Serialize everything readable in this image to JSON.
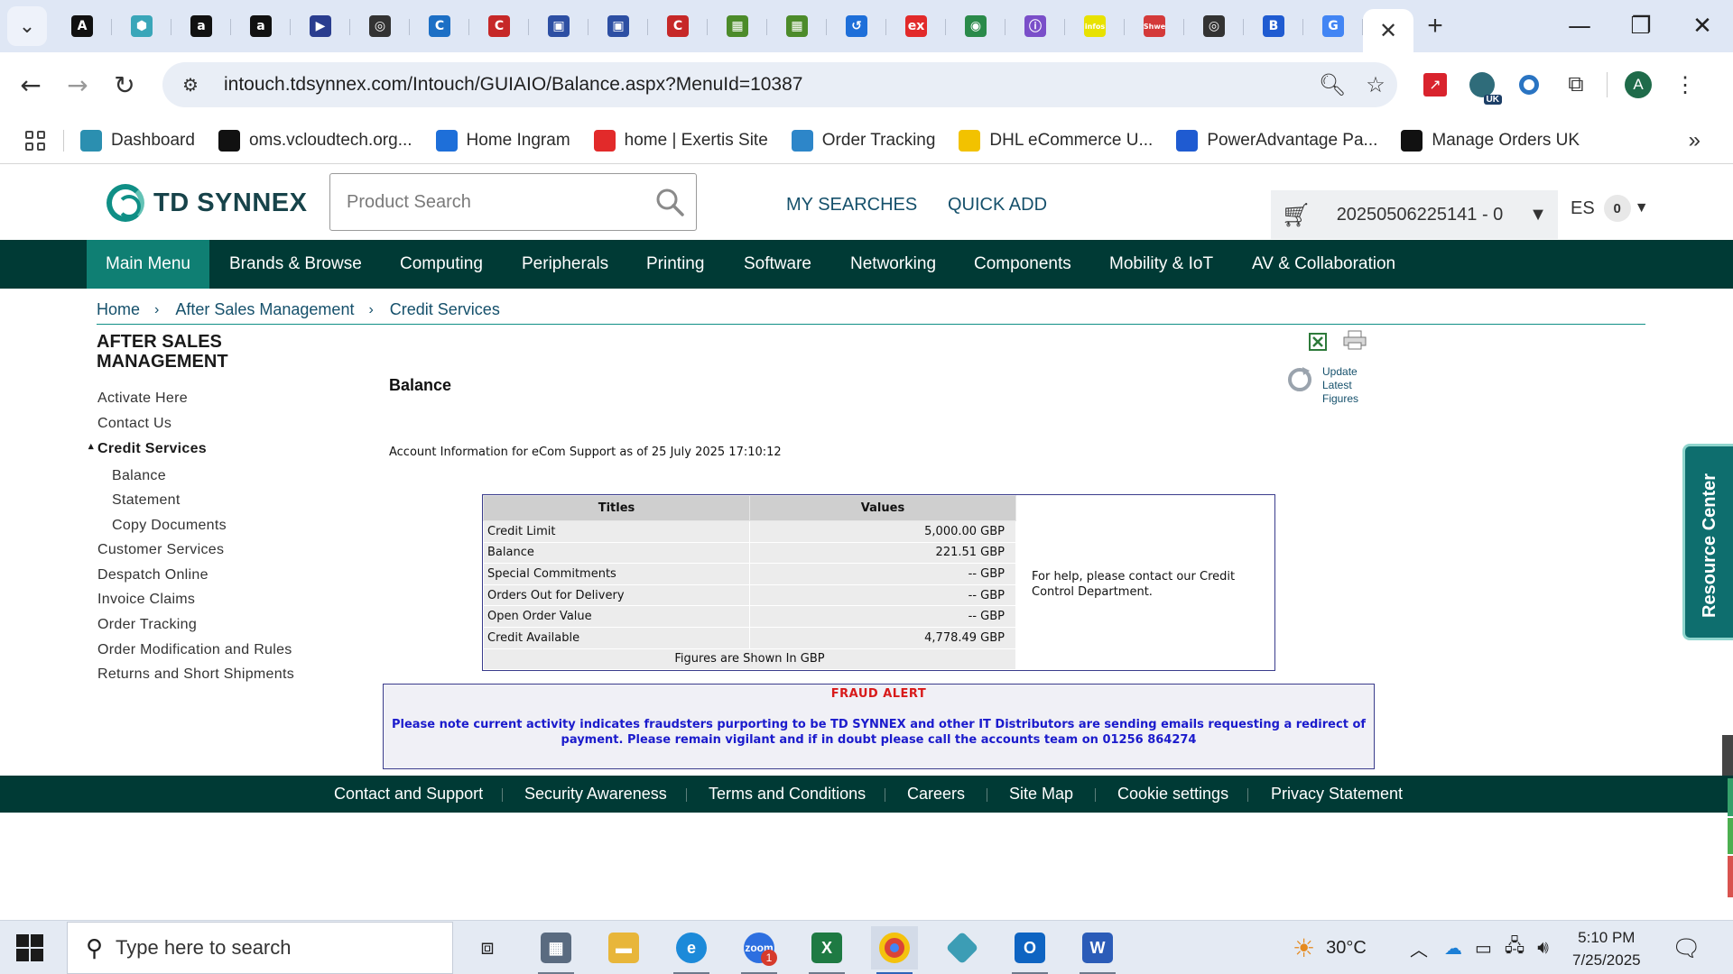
{
  "browser": {
    "tab_close": "✕",
    "new_tab": "+",
    "url": "intouch.tdsynnex.com/Intouch/GUIAIO/Balance.aspx?MenuId=10387",
    "tab_favicons": [
      "A",
      "⬢",
      "a",
      "a",
      "▶",
      "◎",
      "C",
      "C",
      "▣",
      "▣",
      "C",
      "▦",
      "▦",
      "↺",
      "ex",
      "◉",
      "ⓘ",
      "infos",
      "Shwe",
      "◎",
      "B",
      "G"
    ],
    "ext_badge": "UK",
    "profile_initial": "A",
    "bookmarks": [
      {
        "label": "Dashboard",
        "icon": "hexagon-icon",
        "color": "#2b8fb0"
      },
      {
        "label": "oms.vcloudtech.org...",
        "icon": "triangle-icon",
        "color": "#111111"
      },
      {
        "label": "Home Ingram",
        "icon": "ingram-icon",
        "color": "#1e6fd9"
      },
      {
        "label": "home | Exertis Site",
        "icon": "exertis-icon",
        "color": "#e22a2a"
      },
      {
        "label": "Order Tracking",
        "icon": "tracking-icon",
        "color": "#2d86c9"
      },
      {
        "label": "DHL eCommerce U...",
        "icon": "dhl-icon",
        "color": "#f2c200"
      },
      {
        "label": "PowerAdvantage Pa...",
        "icon": "power-icon",
        "color": "#1f5bd1"
      },
      {
        "label": "Manage Orders UK",
        "icon": "amazon-icon",
        "color": "#111111"
      }
    ]
  },
  "header": {
    "logo_text": "TD SYNNEX",
    "search_placeholder": "Product Search",
    "my_searches": "MY SEARCHES",
    "quick_add": "QUICK ADD",
    "quote_number": "20250506225141 - 0",
    "language": "ES",
    "cart_count": "0"
  },
  "nav": [
    "Main Menu",
    "Brands & Browse",
    "Computing",
    "Peripherals",
    "Printing",
    "Software",
    "Networking",
    "Components",
    "Mobility & IoT",
    "AV & Collaboration"
  ],
  "breadcrumb": [
    "Home",
    "After Sales Management",
    "Credit Services"
  ],
  "sidebar": {
    "title": "AFTER SALES MANAGEMENT",
    "items": [
      "Activate Here",
      "Contact Us",
      "Credit Services",
      "Balance",
      "Statement",
      "Copy Documents",
      "Customer Services",
      "Despatch Online",
      "Invoice Claims",
      "Order Tracking",
      "Order Modification and Rules",
      "Returns and Short Shipments"
    ]
  },
  "content": {
    "title": "Balance",
    "update_label": "Update Latest Figures",
    "account_info": "Account Information for eCom Support as of 25 July 2025 17:10:12",
    "table": {
      "headers": [
        "Titles",
        "Values"
      ],
      "rows": [
        [
          "Credit Limit",
          "5,000.00 GBP"
        ],
        [
          "Balance",
          "221.51 GBP"
        ],
        [
          "Special Commitments",
          "-- GBP"
        ],
        [
          "Orders Out for Delivery",
          "-- GBP"
        ],
        [
          "Open Order Value",
          "-- GBP"
        ],
        [
          "Credit Available",
          "4,778.49 GBP"
        ]
      ],
      "footer": "Figures are Shown In GBP"
    },
    "help_text": "For help, please contact our Credit Control Department."
  },
  "fraud": {
    "title": "FRAUD ALERT",
    "body": "Please note current activity indicates fraudsters purporting to be TD SYNNEX and other IT Distributors are sending emails requesting a redirect of payment. Please remain vigilant and if in doubt please call the accounts team on 01256 864274"
  },
  "footer": [
    "Contact and Support",
    "Security Awareness",
    "Terms and Conditions",
    "Careers",
    "Site Map",
    "Cookie settings",
    "Privacy Statement"
  ],
  "resource_center": "Resource Center",
  "taskbar": {
    "search_placeholder": "Type here to search",
    "zoom_badge": "1",
    "temperature": "30°C",
    "time": "5:10 PM",
    "date": "7/25/2025"
  }
}
